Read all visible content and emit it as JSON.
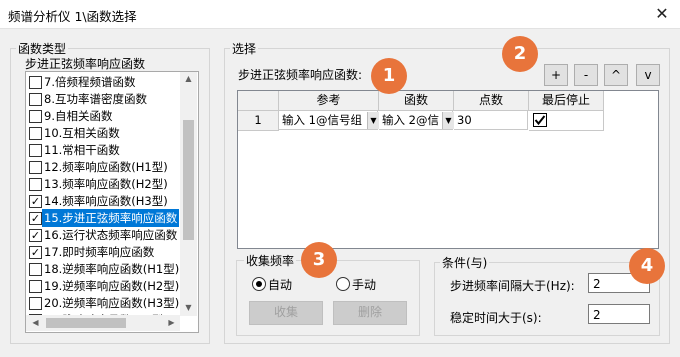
{
  "window": {
    "title": "频谱分析仪 1\\函数选择",
    "close_glyph": "✕"
  },
  "function_type": {
    "group_label": "函数类型",
    "selected_label": "步进正弦频率响应函数",
    "items": [
      {
        "label": "7.倍频程频谱函数",
        "checked": false,
        "selected": false
      },
      {
        "label": "8.互功率谱密度函数",
        "checked": false,
        "selected": false
      },
      {
        "label": "9.自相关函数",
        "checked": false,
        "selected": false
      },
      {
        "label": "10.互相关函数",
        "checked": false,
        "selected": false
      },
      {
        "label": "11.常相干函数",
        "checked": false,
        "selected": false
      },
      {
        "label": "12.频率响应函数(H1型)",
        "checked": false,
        "selected": false
      },
      {
        "label": "13.频率响应函数(H2型)",
        "checked": false,
        "selected": false
      },
      {
        "label": "14.频率响应函数(H3型)",
        "checked": true,
        "selected": false
      },
      {
        "label": "15.步进正弦频率响应函数",
        "checked": true,
        "selected": true
      },
      {
        "label": "16.运行状态频率响应函数",
        "checked": true,
        "selected": false
      },
      {
        "label": "17.即时频率响应函数",
        "checked": true,
        "selected": false
      },
      {
        "label": "18.逆频率响应函数(H1型)",
        "checked": false,
        "selected": false
      },
      {
        "label": "19.逆频率响应函数(H2型)",
        "checked": false,
        "selected": false
      },
      {
        "label": "20.逆频率响应函数(H3型)",
        "checked": false,
        "selected": false
      },
      {
        "label": "21.脉冲响应函数(H1型)",
        "checked": false,
        "selected": false
      }
    ]
  },
  "selection": {
    "group_label": "选择",
    "heading": "步进正弦频率响应函数:",
    "buttons": {
      "add": "+",
      "remove": "-",
      "up": "^",
      "down": "v"
    },
    "table": {
      "columns": [
        "参考",
        "函数",
        "点数",
        "最后停止"
      ],
      "rows": [
        {
          "index": "1",
          "reference": "输入 1@信号组",
          "function": "输入 2@信",
          "points": "30",
          "last_stop": true
        }
      ]
    }
  },
  "collect_freq": {
    "group_label": "收集频率",
    "auto_label": "自动",
    "manual_label": "手动",
    "mode": "auto",
    "collect_button": "收集",
    "delete_button": "删除"
  },
  "conditions": {
    "group_label": "条件(与)",
    "step_interval_label": "步进频率间隔大于(Hz):",
    "step_interval_value": "2",
    "settle_time_label": "稳定时间大于(s):",
    "settle_time_value": "2"
  },
  "badges": [
    "1",
    "2",
    "3",
    "4"
  ],
  "colors": {
    "badge": "#e8743b",
    "selection": "#0078d7"
  }
}
